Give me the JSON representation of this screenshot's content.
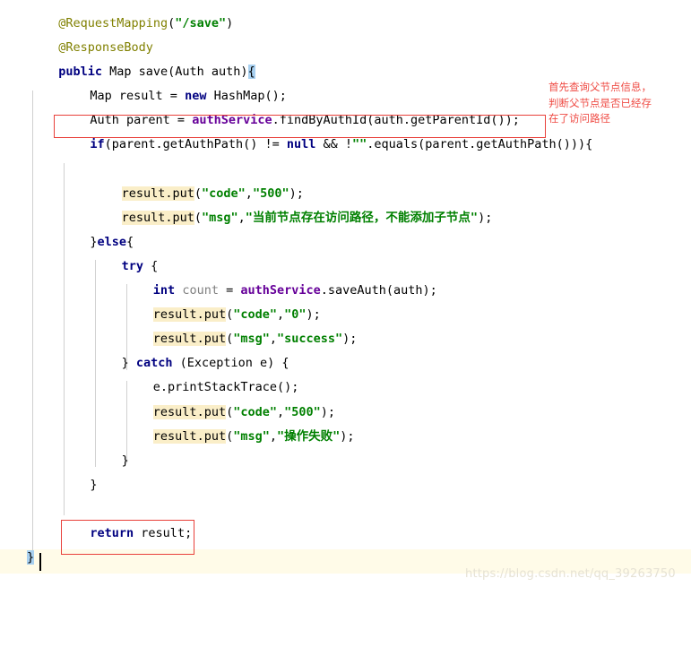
{
  "editor": {
    "language": "java",
    "colors": {
      "keyword": "#000080",
      "annotation": "#808000",
      "string": "#008000",
      "field": "#660099",
      "unused_variable": "#808080",
      "plain_text": "#000000",
      "search_highlight": "#faeec8",
      "brace_match": "#a8d0f0",
      "current_line": "#fffbe8",
      "indent_guide": "#d0d0d0",
      "annotation_red": "#ef4b44",
      "background": "#ffffff"
    },
    "lines": [
      {
        "n": 1,
        "indent": 1,
        "tokens": [
          {
            "t": "@RequestMapping",
            "c": "anno"
          },
          {
            "t": "(",
            "c": "plain"
          },
          {
            "t": "\"/save\"",
            "c": "str"
          },
          {
            "t": ")",
            "c": "plain"
          }
        ]
      },
      {
        "n": 2,
        "indent": 1,
        "tokens": [
          {
            "t": "@ResponseBody",
            "c": "anno"
          }
        ]
      },
      {
        "n": 3,
        "indent": 1,
        "tokens": [
          {
            "t": "public",
            "c": "kw"
          },
          {
            "t": " Map save(Auth auth)",
            "c": "plain"
          },
          {
            "t": "{",
            "c": "brace-sel"
          }
        ]
      },
      {
        "n": 4,
        "indent": 2,
        "tokens": [
          {
            "t": "Map result = ",
            "c": "plain"
          },
          {
            "t": "new",
            "c": "kw"
          },
          {
            "t": " HashMap();",
            "c": "plain"
          }
        ]
      },
      {
        "n": 5,
        "indent": 2,
        "tokens": [
          {
            "t": "Auth parent = ",
            "c": "plain"
          },
          {
            "t": "authService",
            "c": "field"
          },
          {
            "t": ".findByAuthId(auth.getParentId());",
            "c": "plain"
          }
        ]
      },
      {
        "n": 6,
        "indent": 2,
        "tokens": [
          {
            "t": "if",
            "c": "kw"
          },
          {
            "t": "(parent.getAuthPath() != ",
            "c": "plain"
          },
          {
            "t": "null",
            "c": "kw"
          },
          {
            "t": " && !",
            "c": "plain"
          },
          {
            "t": "\"\"",
            "c": "str"
          },
          {
            "t": ".equals(parent.getAuthPath())){",
            "c": "plain"
          }
        ]
      },
      {
        "n": 7,
        "indent": 0,
        "tokens": []
      },
      {
        "n": 8,
        "indent": 3,
        "tokens": [
          {
            "t": "result.put",
            "c": "plain hl"
          },
          {
            "t": "(",
            "c": "plain"
          },
          {
            "t": "\"code\"",
            "c": "str"
          },
          {
            "t": ",",
            "c": "plain"
          },
          {
            "t": "\"500\"",
            "c": "str"
          },
          {
            "t": ");",
            "c": "plain"
          }
        ]
      },
      {
        "n": 9,
        "indent": 3,
        "tokens": [
          {
            "t": "result.put",
            "c": "plain hl"
          },
          {
            "t": "(",
            "c": "plain"
          },
          {
            "t": "\"msg\"",
            "c": "str"
          },
          {
            "t": ",",
            "c": "plain"
          },
          {
            "t": "\"当前节点存在访问路径，不能添加子节点\"",
            "c": "str"
          },
          {
            "t": ");",
            "c": "plain"
          }
        ]
      },
      {
        "n": 10,
        "indent": 2,
        "tokens": [
          {
            "t": "}",
            "c": "plain"
          },
          {
            "t": "else",
            "c": "kw"
          },
          {
            "t": "{",
            "c": "plain"
          }
        ]
      },
      {
        "n": 11,
        "indent": 3,
        "tokens": [
          {
            "t": "try",
            "c": "kw"
          },
          {
            "t": " {",
            "c": "plain"
          }
        ]
      },
      {
        "n": 12,
        "indent": 4,
        "tokens": [
          {
            "t": "int",
            "c": "kw"
          },
          {
            "t": " ",
            "c": "plain"
          },
          {
            "t": "count",
            "c": "grey"
          },
          {
            "t": " = ",
            "c": "plain"
          },
          {
            "t": "authService",
            "c": "field"
          },
          {
            "t": ".saveAuth(auth);",
            "c": "plain"
          }
        ]
      },
      {
        "n": 13,
        "indent": 4,
        "tokens": [
          {
            "t": "result.put",
            "c": "plain hl"
          },
          {
            "t": "(",
            "c": "plain"
          },
          {
            "t": "\"code\"",
            "c": "str"
          },
          {
            "t": ",",
            "c": "plain"
          },
          {
            "t": "\"0\"",
            "c": "str"
          },
          {
            "t": ");",
            "c": "plain"
          }
        ]
      },
      {
        "n": 14,
        "indent": 4,
        "tokens": [
          {
            "t": "result.put",
            "c": "plain hl"
          },
          {
            "t": "(",
            "c": "plain"
          },
          {
            "t": "\"msg\"",
            "c": "str"
          },
          {
            "t": ",",
            "c": "plain"
          },
          {
            "t": "\"success\"",
            "c": "str"
          },
          {
            "t": ");",
            "c": "plain"
          }
        ]
      },
      {
        "n": 15,
        "indent": 3,
        "tokens": [
          {
            "t": "} ",
            "c": "plain"
          },
          {
            "t": "catch",
            "c": "kw"
          },
          {
            "t": " (Exception e) {",
            "c": "plain"
          }
        ]
      },
      {
        "n": 16,
        "indent": 4,
        "tokens": [
          {
            "t": "e.printStackTrace();",
            "c": "plain"
          }
        ]
      },
      {
        "n": 17,
        "indent": 4,
        "tokens": [
          {
            "t": "result.put",
            "c": "plain hl"
          },
          {
            "t": "(",
            "c": "plain"
          },
          {
            "t": "\"code\"",
            "c": "str"
          },
          {
            "t": ",",
            "c": "plain"
          },
          {
            "t": "\"500\"",
            "c": "str"
          },
          {
            "t": ");",
            "c": "plain"
          }
        ]
      },
      {
        "n": 18,
        "indent": 4,
        "tokens": [
          {
            "t": "result.put",
            "c": "plain hl"
          },
          {
            "t": "(",
            "c": "plain"
          },
          {
            "t": "\"msg\"",
            "c": "str"
          },
          {
            "t": ",",
            "c": "plain"
          },
          {
            "t": "\"操作失败\"",
            "c": "str"
          },
          {
            "t": ");",
            "c": "plain"
          }
        ]
      },
      {
        "n": 19,
        "indent": 3,
        "tokens": [
          {
            "t": "}",
            "c": "plain"
          }
        ]
      },
      {
        "n": 20,
        "indent": 2,
        "tokens": [
          {
            "t": "}",
            "c": "plain"
          }
        ]
      },
      {
        "n": 21,
        "indent": 0,
        "tokens": []
      },
      {
        "n": 22,
        "indent": 2,
        "tokens": [
          {
            "t": "return",
            "c": "kw"
          },
          {
            "t": " result;",
            "c": "plain"
          }
        ]
      },
      {
        "n": 23,
        "indent": 0,
        "tokens": [
          {
            "t": "}",
            "c": "brace-sel"
          }
        ]
      }
    ]
  },
  "annotations": {
    "note_text": "首先查询父节点信息，\n判断父节点是否已经存\n在了访问路径",
    "boxes": [
      {
        "label": "highlight-box-parent-lookup"
      },
      {
        "label": "highlight-box-return"
      }
    ]
  },
  "watermark": {
    "text": "https://blog.csdn.net/qq_39263750"
  }
}
